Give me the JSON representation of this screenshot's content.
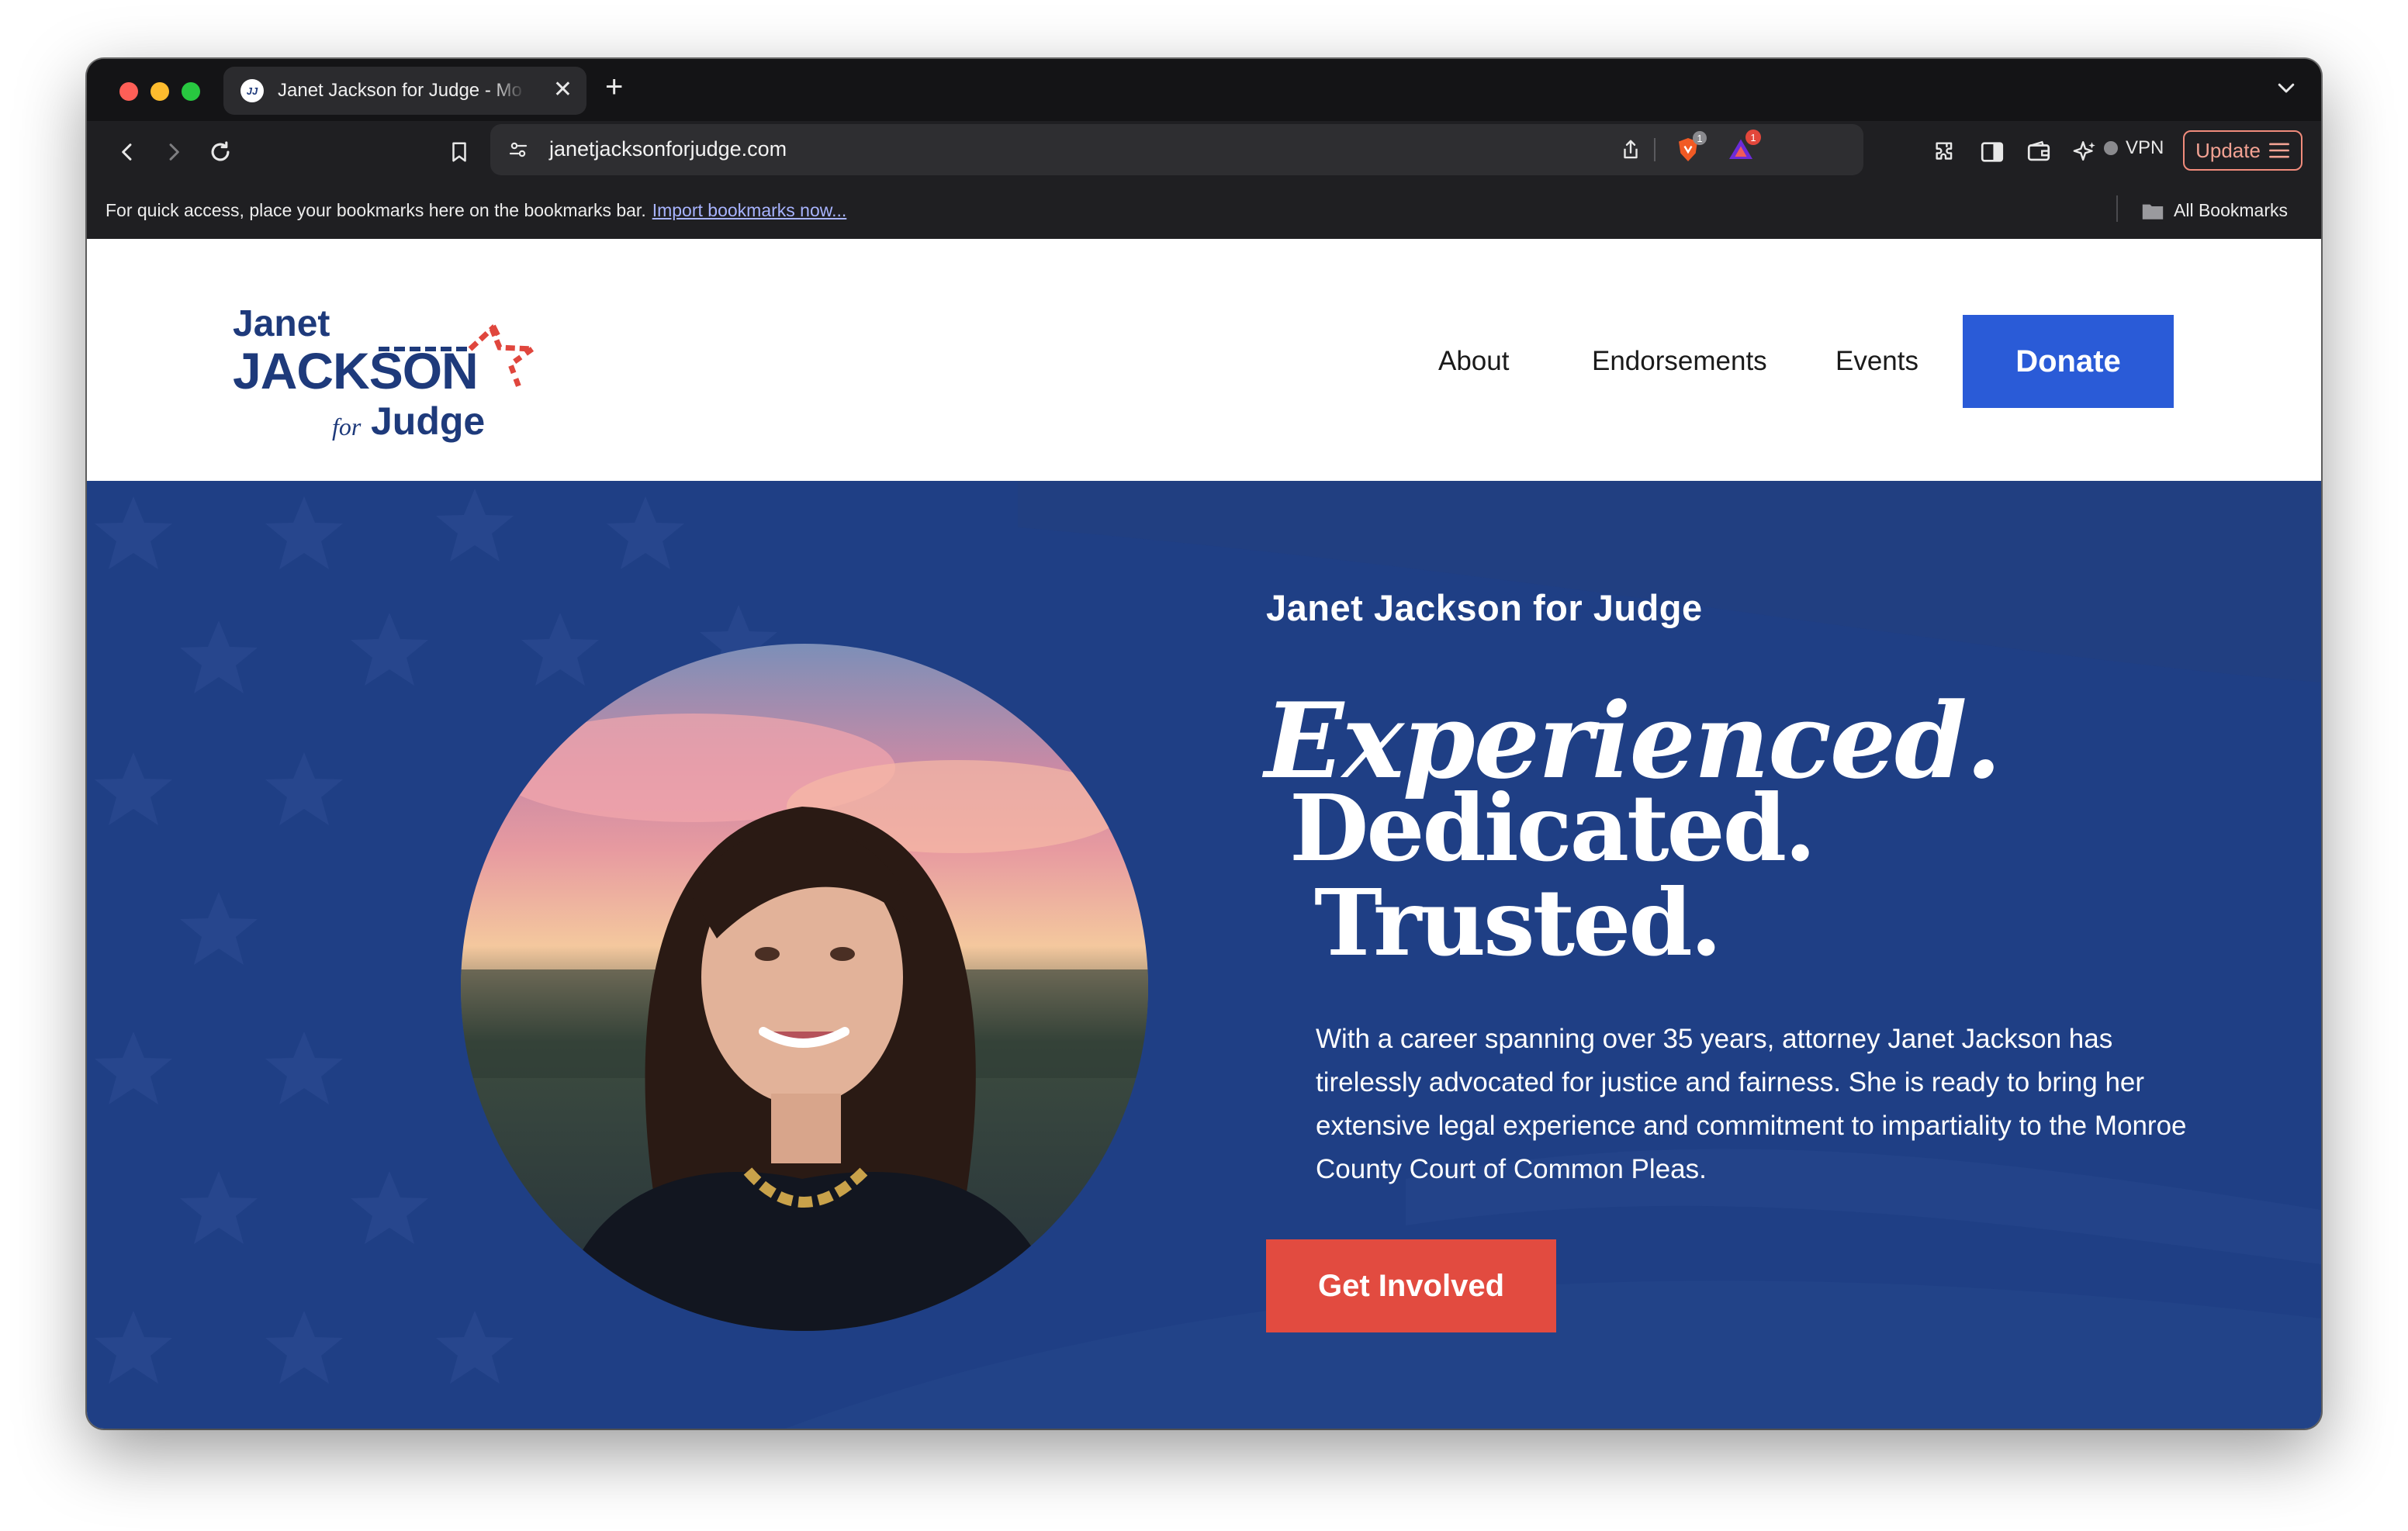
{
  "browser": {
    "tab": {
      "favicon_text": "JJ",
      "title": "Janet Jackson for Judge - Mo",
      "close": "✕"
    },
    "new_tab": "+",
    "url": "janetjacksonforjudge.com",
    "shield_badge": "1",
    "alert_badge": "1",
    "vpn_label": "VPN",
    "update_label": "Update",
    "bookmarks_bar": {
      "message": "For quick access, place your bookmarks here on the bookmarks bar.",
      "import_link": "Import bookmarks now...",
      "all_bookmarks": "All Bookmarks"
    }
  },
  "site": {
    "logo": {
      "line1": "Janet",
      "line2": "JACKSON",
      "for": "for",
      "line3": "Judge"
    },
    "nav": [
      "About",
      "Endorsements",
      "Events"
    ],
    "donate_label": "Donate",
    "hero": {
      "kicker": "Janet Jackson for Judge",
      "headline": [
        "Experienced.",
        "Dedicated.",
        "Trusted."
      ],
      "body": "With a career spanning over 35 years, attorney Janet Jackson has tirelessly advocated for justice and fairness. She is ready to bring her extensive legal experience and commitment to impartiality to the Monroe County Court of Common Pleas.",
      "cta_label": "Get Involved"
    }
  },
  "colors": {
    "brand_navy": "#1e3a7b",
    "hero_blue": "#1f3f85",
    "donate_blue": "#2a5bd7",
    "cta_red": "#e24b40"
  }
}
